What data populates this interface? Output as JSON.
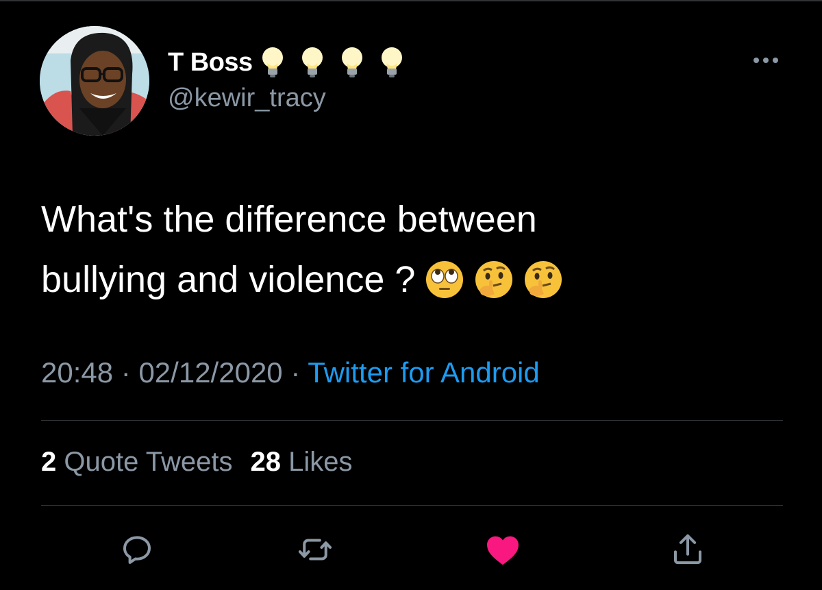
{
  "tweet": {
    "author": {
      "display_name": "T Boss",
      "name_emojis": [
        "light-bulb-emoji",
        "light-bulb-emoji",
        "light-bulb-emoji",
        "light-bulb-emoji"
      ],
      "handle": "@kewir_tracy"
    },
    "text_line1": "What's the difference between",
    "text_line2": "bullying and violence ?",
    "text_emojis": [
      "face-with-rolling-eyes-emoji",
      "thinking-face-emoji",
      "thinking-face-emoji"
    ],
    "time": "20:48",
    "separator": "·",
    "date": "02/12/2020",
    "source": "Twitter for Android",
    "quote_tweets_count": "2",
    "quote_tweets_label": "Quote Tweets",
    "likes_count": "28",
    "likes_label": "Likes",
    "liked": true
  },
  "actions": [
    {
      "icon": "reply-icon"
    },
    {
      "icon": "retweet-icon"
    },
    {
      "icon": "heart-icon",
      "active": true
    },
    {
      "icon": "share-icon"
    }
  ],
  "colors": {
    "background": "#000000",
    "primary_text": "#ffffff",
    "secondary_text": "#8b98a5",
    "accent": "#1d9bf0",
    "like": "#f91880",
    "divider": "#2f3336"
  }
}
